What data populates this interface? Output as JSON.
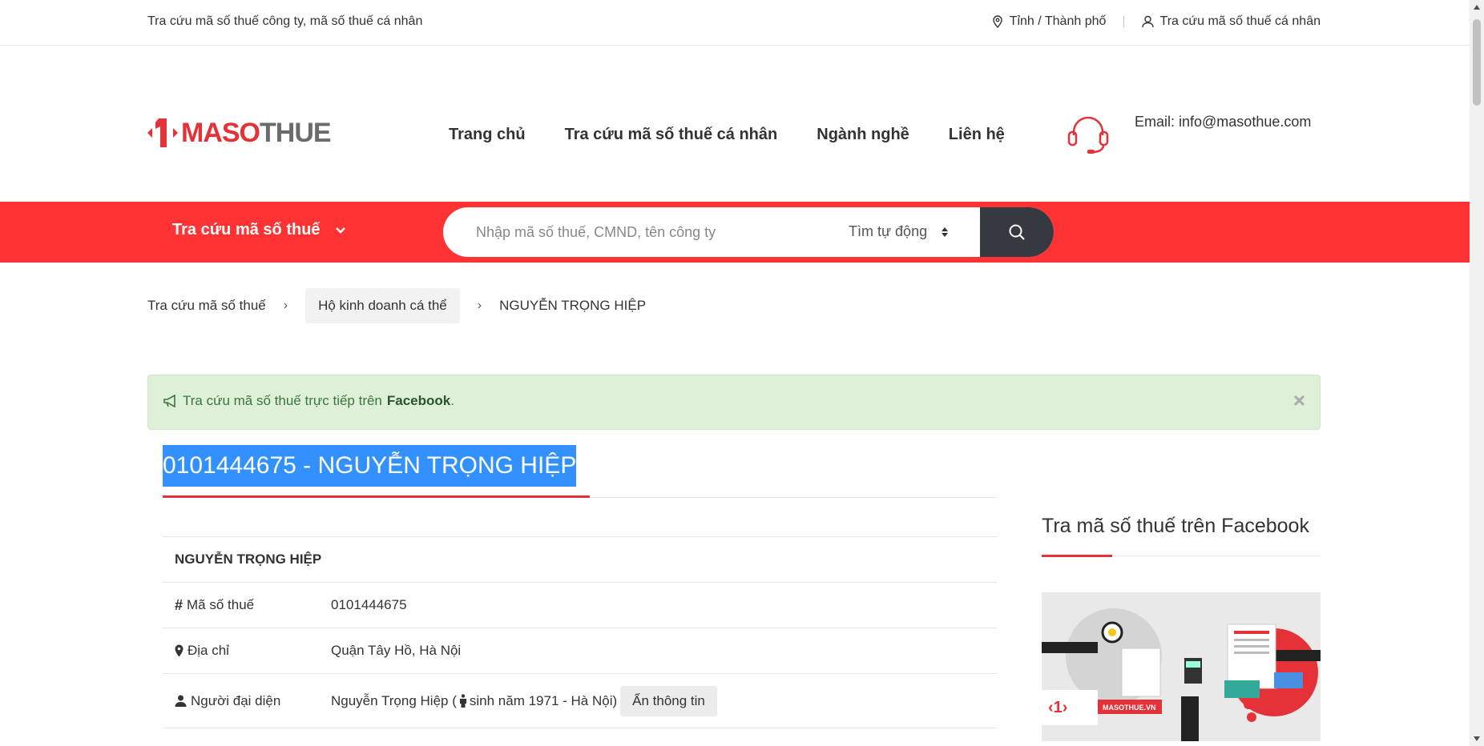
{
  "topbar": {
    "tagline": "Tra cứu mã số thuế công ty, mã số thuế cá nhân",
    "province_label": "Tỉnh / Thành phố",
    "personal_lookup_label": "Tra cứu mã số thuế cá nhân"
  },
  "header": {
    "logo_maso": "MASO",
    "logo_thue": "THUE",
    "nav": [
      "Trang chủ",
      "Tra cứu mã số thuế cá nhân",
      "Ngành nghề",
      "Liên hệ"
    ],
    "email": "Email: info@masothue.com"
  },
  "searchbar": {
    "category_label": "Tra cứu mã số thuế",
    "placeholder": "Nhập mã số thuế, CMND, tên công ty",
    "mode_label": "Tìm tự động"
  },
  "breadcrumb": [
    "Tra cứu mã số thuế",
    "Hộ kinh doanh cá thể",
    "NGUYỄN TRỌNG HIỆP"
  ],
  "alert": {
    "text": "Tra cứu mã số thuế trực tiếp trên",
    "link": "Facebook",
    "suffix": ".",
    "close": "×"
  },
  "title": "0101444675 - NGUYỄN TRỌNG HIỆP",
  "info": {
    "name": "NGUYỄN TRỌNG HIỆP",
    "rows": [
      {
        "label": "Mã số thuế",
        "value": "0101444675"
      },
      {
        "label": "Địa chỉ",
        "value": "Quận Tây Hồ, Hà Nội"
      },
      {
        "label": "Người đại diện",
        "value_prefix": "Nguyễn Trọng Hiệp (",
        "value_suffix": "sinh năm 1971 - Hà Nội)",
        "button": "Ẩn thông tin"
      }
    ]
  },
  "sidebar": {
    "title": "Tra mã số thuế trên Facebook",
    "image_caption": "MASOTHUE.VN"
  },
  "colors": {
    "brand_red": "#ff3333",
    "dark": "#343a40",
    "alert_bg": "#dff0d8",
    "selection": "#3390ff"
  }
}
